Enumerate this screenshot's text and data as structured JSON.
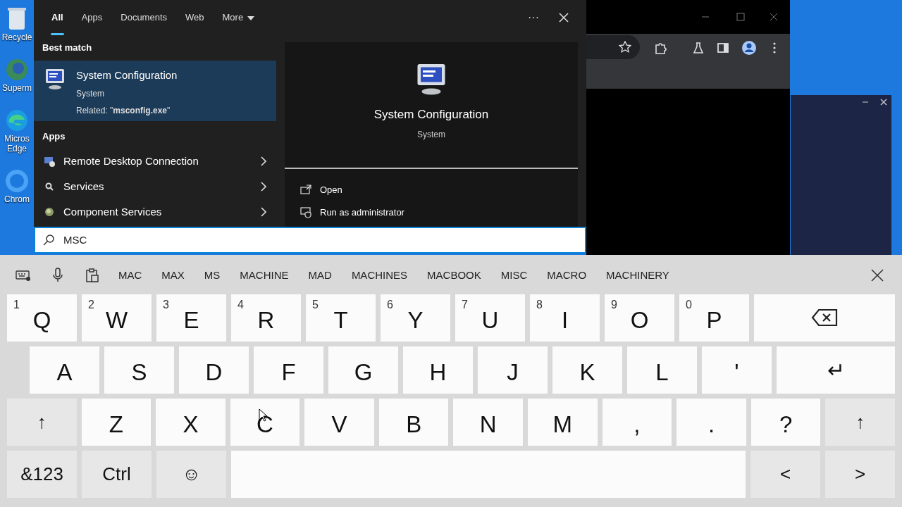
{
  "desktop_icons": [
    {
      "lines": [
        "Recycle"
      ],
      "kind": "bin"
    },
    {
      "lines": [
        "Superm"
      ],
      "kind": "globe"
    },
    {
      "lines": [
        "Micros",
        "Edge"
      ],
      "kind": "edge"
    },
    {
      "lines": [
        "Chrom"
      ],
      "kind": "ring"
    }
  ],
  "search": {
    "tabs": [
      {
        "label": "All",
        "selected": true
      },
      {
        "label": "Apps",
        "selected": false
      },
      {
        "label": "Documents",
        "selected": false
      },
      {
        "label": "Web",
        "selected": false
      },
      {
        "label": "More",
        "selected": false,
        "dropdown": true
      }
    ],
    "more_button": "···",
    "best_match_heading": "Best match",
    "best_match": {
      "title": "System Configuration",
      "subtitle": "System",
      "related": "Related: \"**msconfig.exe**\"",
      "selected": true
    },
    "apps_heading": "Apps",
    "apps": [
      {
        "label": "Remote Desktop Connection",
        "kind": "remote"
      },
      {
        "label": "Services",
        "kind": "services"
      },
      {
        "label": "Component Services",
        "kind": "component"
      }
    ],
    "preview": {
      "title": "System Configuration",
      "subtitle": "System",
      "actions": [
        {
          "label": "Open",
          "kind": "open"
        },
        {
          "label": "Run as administrator",
          "kind": "admin"
        }
      ]
    },
    "query": "MSC"
  },
  "keyboard": {
    "suggestions": [
      "MAC",
      "MAX",
      "MS",
      "MACHINE",
      "MAD",
      "MACHINES",
      "MACBOOK",
      "MISC",
      "MACRO",
      "MACHINERY"
    ],
    "rows": [
      {
        "keys": [
          {
            "label": "Q",
            "hint": "1",
            "kind": "letter"
          },
          {
            "label": "W",
            "hint": "2",
            "kind": "letter"
          },
          {
            "label": "E",
            "hint": "3",
            "kind": "letter"
          },
          {
            "label": "R",
            "hint": "4",
            "kind": "letter"
          },
          {
            "label": "T",
            "hint": "5",
            "kind": "letter"
          },
          {
            "label": "Y",
            "hint": "6",
            "kind": "letter"
          },
          {
            "label": "U",
            "hint": "7",
            "kind": "letter"
          },
          {
            "label": "I",
            "hint": "8",
            "kind": "letter"
          },
          {
            "label": "O",
            "hint": "9",
            "kind": "letter"
          },
          {
            "label": "P",
            "hint": "0",
            "kind": "letter"
          },
          {
            "kind": "backspace"
          }
        ]
      },
      {
        "keys": [
          {
            "label": "A",
            "kind": "letter"
          },
          {
            "label": "S",
            "kind": "letter"
          },
          {
            "label": "D",
            "kind": "letter"
          },
          {
            "label": "F",
            "kind": "letter"
          },
          {
            "label": "G",
            "kind": "letter"
          },
          {
            "label": "H",
            "kind": "letter"
          },
          {
            "label": "J",
            "kind": "letter"
          },
          {
            "label": "K",
            "kind": "letter"
          },
          {
            "label": "L",
            "kind": "letter"
          },
          {
            "label": "'",
            "kind": "letter"
          },
          {
            "label": "↵",
            "kind": "wide"
          }
        ]
      },
      {
        "keys": [
          {
            "label": "↑",
            "kind": "function"
          },
          {
            "label": "Z",
            "kind": "letter"
          },
          {
            "label": "X",
            "kind": "letter"
          },
          {
            "label": "C",
            "kind": "letter"
          },
          {
            "label": "V",
            "kind": "letter"
          },
          {
            "label": "B",
            "kind": "letter"
          },
          {
            "label": "N",
            "kind": "letter"
          },
          {
            "label": "M",
            "kind": "letter"
          },
          {
            "label": ",",
            "kind": "letter"
          },
          {
            "label": ".",
            "kind": "letter"
          },
          {
            "label": "?",
            "kind": "letter"
          },
          {
            "label": "↑",
            "kind": "function"
          }
        ]
      },
      {
        "keys": [
          {
            "label": "&123",
            "kind": "function"
          },
          {
            "label": "Ctrl",
            "kind": "function"
          },
          {
            "label": "☺",
            "kind": "function"
          },
          {
            "kind": "space"
          },
          {
            "label": "<",
            "kind": "function"
          },
          {
            "label": ">",
            "kind": "function"
          }
        ]
      }
    ]
  }
}
